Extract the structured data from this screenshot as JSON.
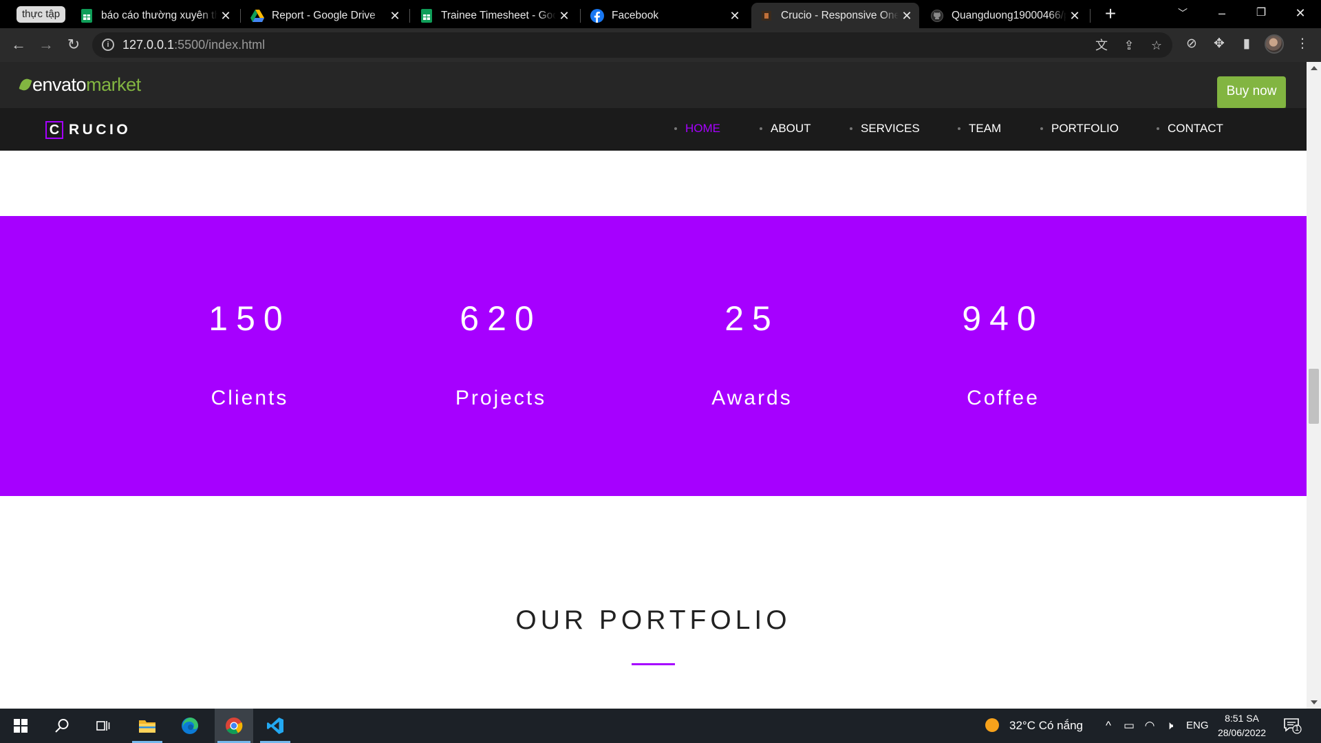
{
  "browser": {
    "tab_group_label": "thực tập",
    "tabs": [
      {
        "title": "báo cáo thường xuyên th",
        "icon": "google-sheets-icon"
      },
      {
        "title": "Report - Google Drive",
        "icon": "google-drive-icon"
      },
      {
        "title": "Trainee Timesheet - Goo",
        "icon": "google-sheets-icon"
      },
      {
        "title": "Facebook",
        "icon": "facebook-icon"
      },
      {
        "title": "Crucio - Responsive One",
        "icon": "crucio-favicon",
        "active": true
      },
      {
        "title": "Quangduong19000466/p",
        "icon": "github-icon"
      }
    ],
    "url_host": "127.0.0.1",
    "url_path": ":5500/index.html"
  },
  "envato": {
    "logo_part1": "envato",
    "logo_part2": "market",
    "buy_now": "Buy now"
  },
  "site": {
    "brand_c": "C",
    "brand_rest": "RUCIO",
    "nav": [
      {
        "label": "HOME",
        "active": true
      },
      {
        "label": "ABOUT"
      },
      {
        "label": "SERVICES"
      },
      {
        "label": "TEAM"
      },
      {
        "label": "PORTFOLIO"
      },
      {
        "label": "CONTACT"
      }
    ],
    "counters": [
      {
        "value": "150",
        "label": "Clients"
      },
      {
        "value": "620",
        "label": "Projects"
      },
      {
        "value": "25",
        "label": "Awards"
      },
      {
        "value": "940",
        "label": "Coffee"
      }
    ],
    "portfolio_title": "OUR PORTFOLIO"
  },
  "taskbar": {
    "weather": "32°C  Có nắng",
    "language": "ENG",
    "time": "8:51 SA",
    "date": "28/06/2022",
    "notification_count": "1"
  },
  "colors": {
    "accent": "#a600ff",
    "envato_green": "#82b541",
    "nav_bg": "#1b1b1b"
  }
}
